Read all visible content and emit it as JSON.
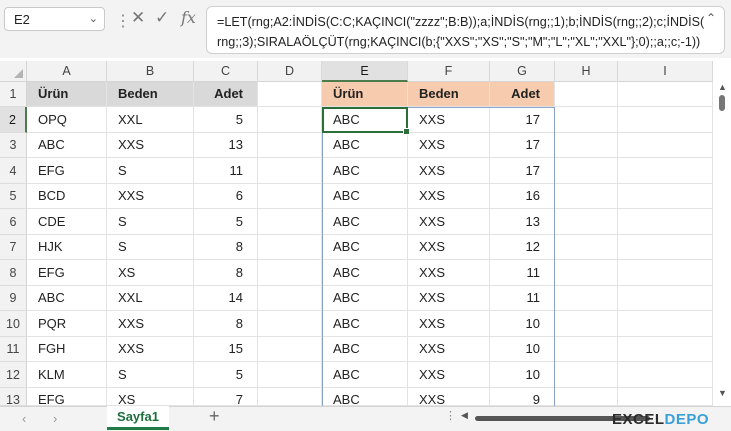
{
  "name_box": {
    "value": "E2"
  },
  "formula_bar": {
    "fx_label": "fx",
    "cancel_icon": "cancel-icon",
    "enter_icon": "checkmark-icon",
    "formula": "=LET(rng;A2:İNDİS(C:C;KAÇINCI(\"zzzz\";B:B));a;İNDİS(rng;;1);b;İNDİS(rng;;2);c;İNDİS(\nrng;;3);SIRALAÖLÇÜT(rng;KAÇINCI(b;{\"XXS\";\"XS\";\"S\";\"M\";\"L\";\"XL\";\"XXL\"};0);;a;;c;-1))"
  },
  "columns": [
    "A",
    "B",
    "C",
    "D",
    "E",
    "F",
    "G",
    "H",
    "I"
  ],
  "selected_column": "E",
  "rows": [
    "1",
    "2",
    "3",
    "4",
    "5",
    "6",
    "7",
    "8",
    "9",
    "10",
    "11",
    "12",
    "13"
  ],
  "selected_row": "2",
  "source_table": {
    "headers": [
      "Ürün",
      "Beden",
      "Adet"
    ],
    "rows": [
      [
        "OPQ",
        "XXL",
        "5"
      ],
      [
        "ABC",
        "XXS",
        "13"
      ],
      [
        "EFG",
        "S",
        "11"
      ],
      [
        "BCD",
        "XXS",
        "6"
      ],
      [
        "CDE",
        "S",
        "5"
      ],
      [
        "HJK",
        "S",
        "8"
      ],
      [
        "EFG",
        "XS",
        "8"
      ],
      [
        "ABC",
        "XXL",
        "14"
      ],
      [
        "PQR",
        "XXS",
        "8"
      ],
      [
        "FGH",
        "XXS",
        "15"
      ],
      [
        "KLM",
        "S",
        "5"
      ],
      [
        "EFG",
        "XS",
        "7"
      ]
    ]
  },
  "result_table": {
    "headers": [
      "Ürün",
      "Beden",
      "Adet"
    ],
    "rows": [
      [
        "ABC",
        "XXS",
        "17"
      ],
      [
        "ABC",
        "XXS",
        "17"
      ],
      [
        "ABC",
        "XXS",
        "17"
      ],
      [
        "ABC",
        "XXS",
        "16"
      ],
      [
        "ABC",
        "XXS",
        "13"
      ],
      [
        "ABC",
        "XXS",
        "12"
      ],
      [
        "ABC",
        "XXS",
        "11"
      ],
      [
        "ABC",
        "XXS",
        "11"
      ],
      [
        "ABC",
        "XXS",
        "10"
      ],
      [
        "ABC",
        "XXS",
        "10"
      ],
      [
        "ABC",
        "XXS",
        "10"
      ],
      [
        "ABC",
        "XXS",
        "9"
      ]
    ]
  },
  "sheet_tabs": [
    {
      "label": "Sayfa1",
      "active": true
    }
  ],
  "add_sheet_label": "+",
  "logo": {
    "part1": "EXCEL",
    "part2": "DEPO"
  },
  "colors": {
    "header_gray": "#d9d9d9",
    "header_orange": "#f7cbad",
    "selection_green": "#2b6e3a",
    "spill_border": "#8aa3c7"
  }
}
